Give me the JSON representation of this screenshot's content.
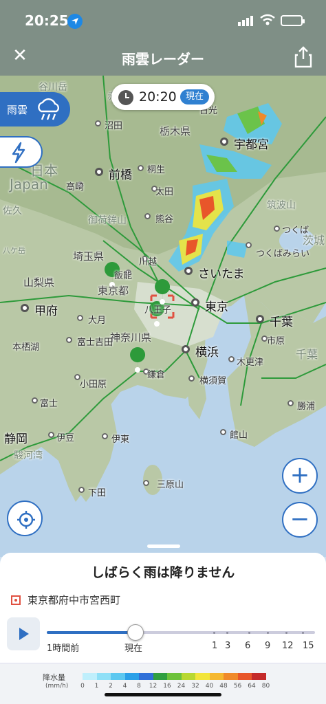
{
  "status": {
    "time": "20:25"
  },
  "nav": {
    "title": "雨雲レーダー"
  },
  "timepill": {
    "time": "20:20",
    "now_label": "現在"
  },
  "layers": {
    "rain_label": "雨雲"
  },
  "map": {
    "labels": {
      "nikko": "日光",
      "utsunomiya": "宇都宮",
      "tochigi_pref": "栃木県",
      "numata": "沼田",
      "maebashi": "前橋",
      "kiryu": "桐生",
      "takasaki": "高崎",
      "ota": "太田",
      "kumagaya": "熊谷",
      "chikuba": "筑波山",
      "tsukuba": "つくば",
      "tsukubamirai": "つくばみらい",
      "saitama_pref": "埼玉県",
      "kawagoe": "川越",
      "iiinou": "飯能",
      "saitama": "さいたま",
      "yamanashi_pref": "山梨県",
      "tokyo_to": "東京都",
      "tokyo": "東京",
      "kofu": "甲府",
      "otsuki": "大月",
      "hachioji": "八王子",
      "chiba": "千葉",
      "kanagawa_pref": "神奈川県",
      "yokohama": "横浜",
      "fujiyoshida": "富士吉田",
      "ichihara": "市原",
      "motosuko": "本栖湖",
      "kisarazu": "木更津",
      "odawara": "小田原",
      "kamakura": "鎌倉",
      "yokosuka": "横須賀",
      "fuji": "富士",
      "katsuura": "勝浦",
      "shizuoka": "静岡",
      "izunokuni": "伊豆",
      "ito": "伊東",
      "tateyama": "館山",
      "surugawan": "駿河湾",
      "mihara": "三原山",
      "shimoda": "下田",
      "japan": "Japan",
      "nippon": "日本",
      "chiba_pref": "千葉",
      "ibaraki_pref": "茨城",
      "sakura": "佐久",
      "hachigatake": "八ケ岳",
      "mikuni": "谷川岳",
      "akagi": "赤城山",
      "ogino": "御荷鉾山"
    }
  },
  "sheet": {
    "message": "しばらく雨は降りません",
    "location": "東京都府中市宮西町",
    "slider": {
      "value_fraction": 0.33,
      "labels": [
        "1時間前",
        "現在",
        "1",
        "3",
        "6",
        "9",
        "12",
        "15"
      ]
    }
  },
  "legend": {
    "title": "降水量",
    "unit": "(mm/h)",
    "values": [
      "0",
      "1",
      "2",
      "4",
      "8",
      "12",
      "16",
      "24",
      "32",
      "40",
      "48",
      "56",
      "64",
      "80"
    ],
    "colors": [
      "#bfeffc",
      "#8fe0f7",
      "#5cc8f0",
      "#2aa0e8",
      "#2f6fd8",
      "#2f9f40",
      "#6cc23a",
      "#b8d830",
      "#f2e53a",
      "#f5b830",
      "#f08a2a",
      "#e8562a",
      "#c42a2a"
    ]
  }
}
